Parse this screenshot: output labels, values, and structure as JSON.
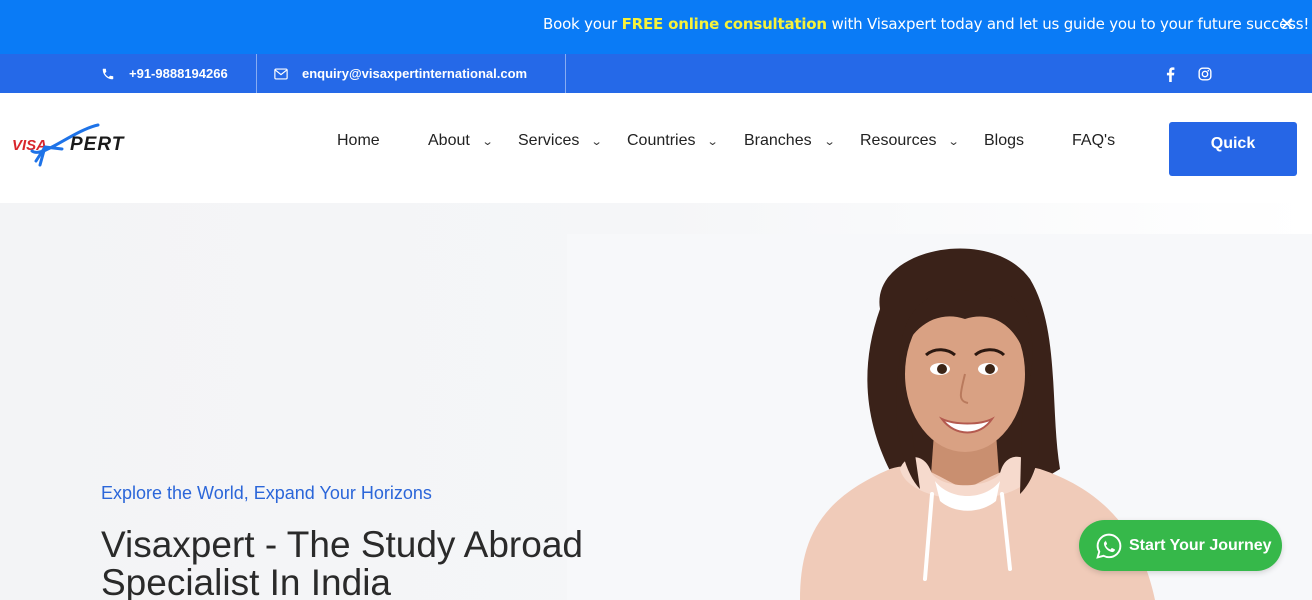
{
  "announcement": {
    "prefix": "Book your ",
    "highlight": "FREE online consultation",
    "suffix": " with Visaxpert today and let us guide you to your future success! Bo",
    "close_icon": "close-icon",
    "highlight_color": "#f7f23a"
  },
  "contact": {
    "phone": "+91-9888194266",
    "email": "enquiry@visaxpertinternational.com",
    "phone_icon": "phone-icon",
    "email_icon": "envelope-icon",
    "social": [
      "facebook-icon",
      "instagram-icon"
    ]
  },
  "header": {
    "logo_text_left": "VISA",
    "logo_text_right": "PERT",
    "nav": [
      {
        "label": "Home",
        "dropdown": false
      },
      {
        "label": "About",
        "dropdown": true
      },
      {
        "label": "Services",
        "dropdown": true
      },
      {
        "label": "Countries",
        "dropdown": true
      },
      {
        "label": "Branches",
        "dropdown": true
      },
      {
        "label": "Resources",
        "dropdown": true
      },
      {
        "label": "Blogs",
        "dropdown": false
      },
      {
        "label": "FAQ's",
        "dropdown": false
      }
    ],
    "quick_button": "Quick",
    "brand_color": "#2666e6"
  },
  "hero": {
    "tagline": "Explore the World, Expand Your Horizons",
    "title": "Visaxpert - The Study Abroad Specialist In India"
  },
  "whatsapp": {
    "label": "Start Your Journey",
    "icon": "whatsapp-icon",
    "color": "#36b84a"
  }
}
